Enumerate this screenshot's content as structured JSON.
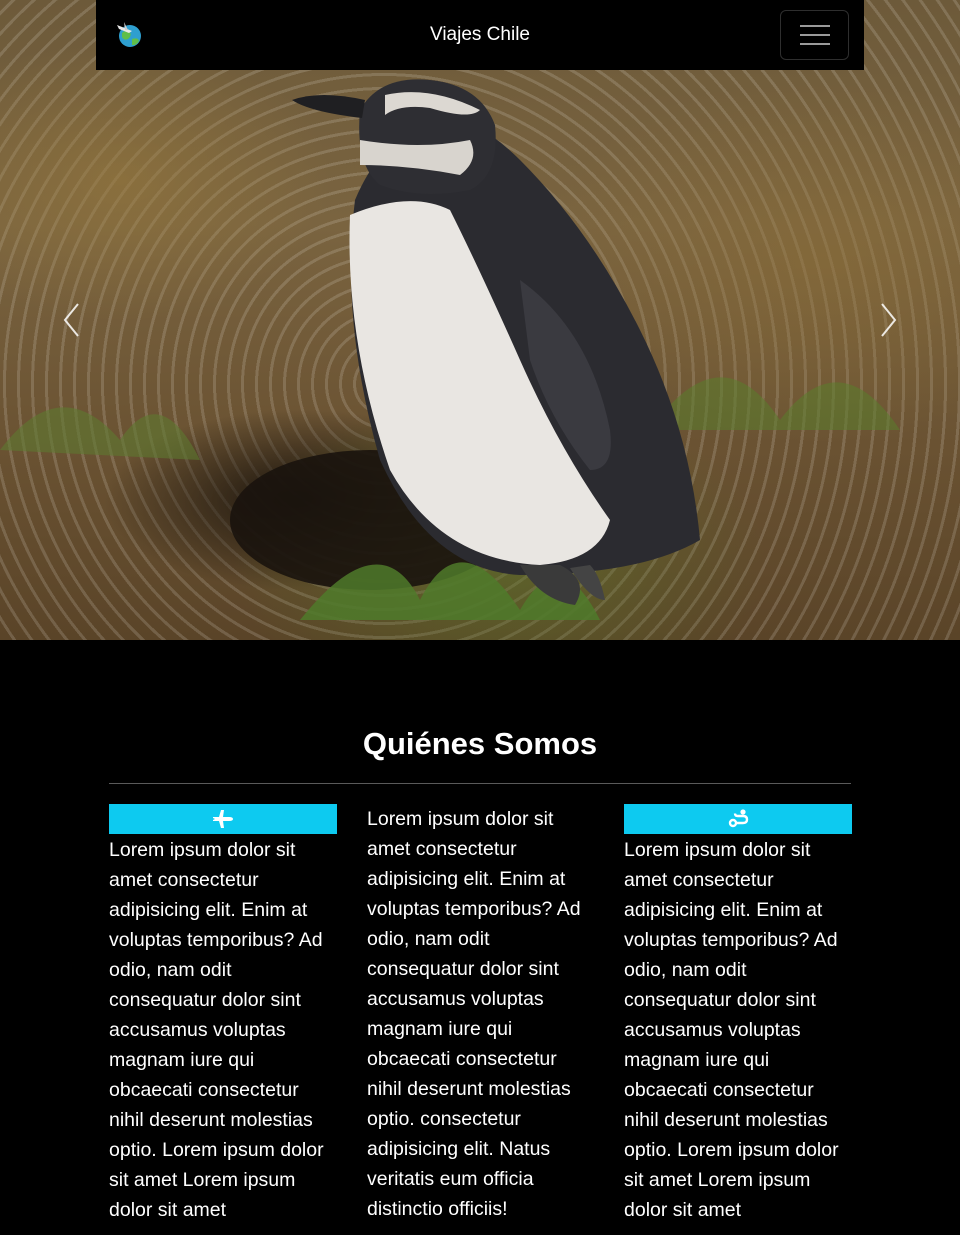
{
  "navbar": {
    "brand_title": "Viajes Chile",
    "logo_icon": "globe-plane-icon",
    "toggler_icon": "hamburger-icon"
  },
  "carousel": {
    "image_subject": "penguin",
    "prev_icon": "chevron-left-icon",
    "next_icon": "chevron-right-icon"
  },
  "about": {
    "title": "Quiénes Somos",
    "columns": [
      {
        "icon": "airplane-icon",
        "text": "Lorem ipsum dolor sit amet consectetur adipisicing elit. Enim at voluptas temporibus? Ad odio, nam odit consequatur dolor sint accusamus voluptas magnam iure qui obcaecati consectetur nihil deserunt molestias optio. Lorem ipsum dolor sit amet Lorem ipsum dolor sit amet"
      },
      {
        "icon": "",
        "text": "Lorem ipsum dolor sit amet consectetur adipisicing elit. Enim at voluptas temporibus? Ad odio, nam odit consequatur dolor sint accusamus voluptas magnam iure qui obcaecati consectetur nihil deserunt molestias optio. consectetur adipisicing elit. Natus veritatis eum officia distinctio officiis!"
      },
      {
        "icon": "route-icon",
        "text": "Lorem ipsum dolor sit amet consectetur adipisicing elit. Enim at voluptas temporibus? Ad odio, nam odit consequatur dolor sint accusamus voluptas magnam iure qui obcaecati consectetur nihil deserunt molestias optio. Lorem ipsum dolor sit amet Lorem ipsum dolor sit amet"
      }
    ]
  },
  "colors": {
    "accent": "#0dcaf0",
    "background": "#000000",
    "text": "#ffffff"
  }
}
